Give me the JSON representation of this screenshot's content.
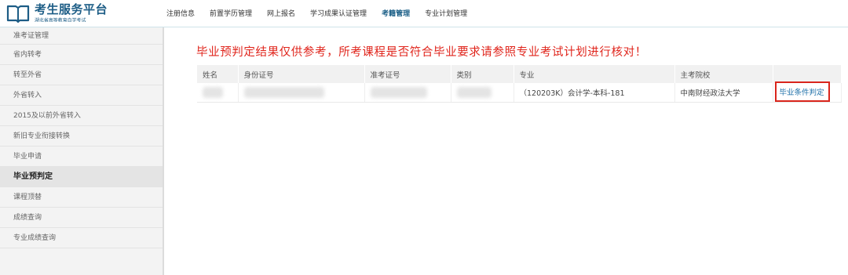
{
  "header": {
    "logo_title": "考生服务平台",
    "logo_subtitle": "湖北省高等教育自学考试",
    "nav": [
      {
        "label": "注册信息",
        "active": false
      },
      {
        "label": "前置学历管理",
        "active": false
      },
      {
        "label": "网上报名",
        "active": false
      },
      {
        "label": "学习成果认证管理",
        "active": false
      },
      {
        "label": "考籍管理",
        "active": true
      },
      {
        "label": "专业计划管理",
        "active": false
      }
    ]
  },
  "sidebar": {
    "items": [
      {
        "label": "准考证管理"
      },
      {
        "label": "省内转考"
      },
      {
        "label": "转至外省"
      },
      {
        "label": "外省转入"
      },
      {
        "label": "2015及以前外省转入"
      },
      {
        "label": "新旧专业衔接转换"
      },
      {
        "label": "毕业申请"
      },
      {
        "label": "毕业预判定",
        "active": true
      },
      {
        "label": "课程顶替"
      },
      {
        "label": "成绩查询"
      },
      {
        "label": "专业成绩查询"
      }
    ]
  },
  "main": {
    "notice": "毕业预判定结果仅供参考，所考课程是否符合毕业要求请参照专业考试计划进行核对！",
    "table": {
      "columns": [
        "姓名",
        "身份证号",
        "准考证号",
        "类别",
        "专业",
        "主考院校",
        ""
      ],
      "rows": [
        {
          "name": "",
          "id_number": "",
          "exam_number": "",
          "category": "",
          "major": "（120203K）会计学-本科-181",
          "school": "中南财经政法大学",
          "action": "毕业条件判定"
        }
      ]
    }
  },
  "colors": {
    "brand": "#1d5d86",
    "notice_red": "#e0251c",
    "highlight_box": "#d9251c",
    "link": "#1c6fa8"
  }
}
